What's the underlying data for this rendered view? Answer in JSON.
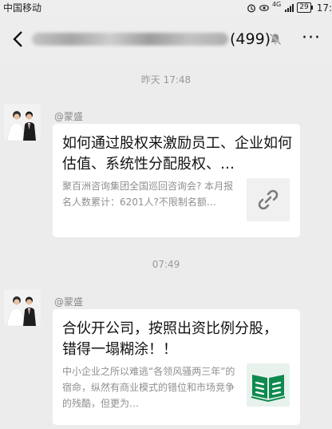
{
  "status_bar": {
    "carrier": "中国移动",
    "network": "4G",
    "battery": "29",
    "time": "17:"
  },
  "header": {
    "count": "(499)",
    "back_icon": "back-arrow-icon",
    "mute_icon": "muted-bell-icon",
    "more_label": "···"
  },
  "messages": [
    {
      "timestamp": "昨天 17:48",
      "sender": "@蒙盛",
      "title": "如何通过股权来激励员工、企业如何估值、系统性分配股权、…",
      "description": "聚百洲咨询集团全国巡回咨询会? 本月报名人数累计：6201人?不限制名额…",
      "thumb_icon": "link-icon",
      "thumb_color": "#f0f0f0"
    },
    {
      "timestamp": "07:49",
      "sender": "@蒙盛",
      "title": "合伙开公司，按照出资比例分股，错得一塌糊涂！！",
      "description": "中小企业之所以难逃“各领风骚两三年”的宿命，纵然有商业模式的错位和市场竞争的残酷，但更为…",
      "thumb_icon": "open-book-icon",
      "thumb_color": "#e8f2ec"
    }
  ]
}
